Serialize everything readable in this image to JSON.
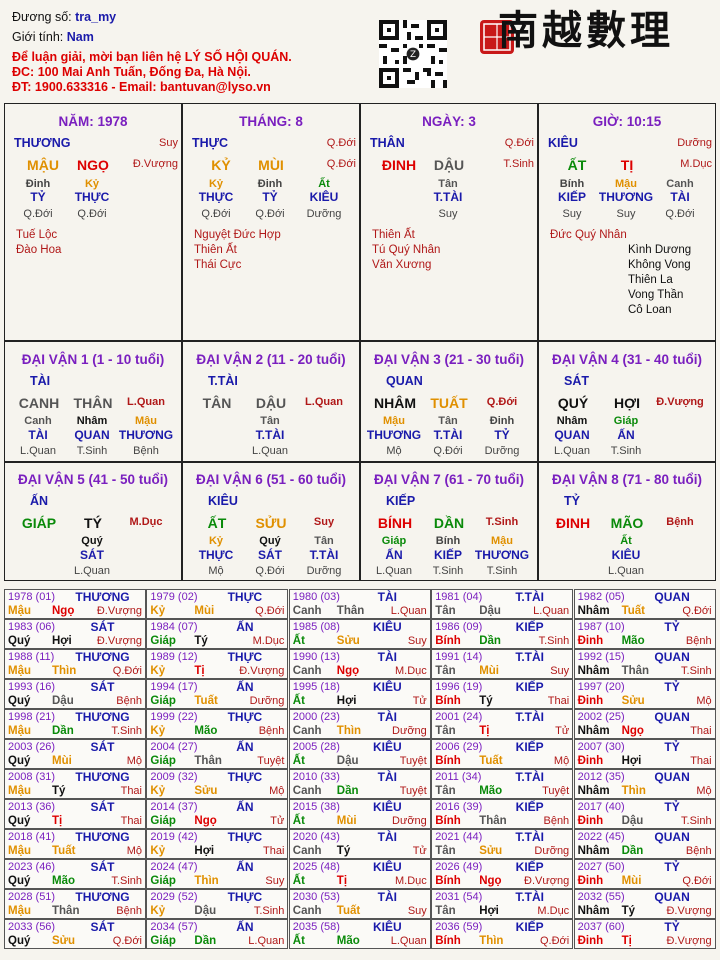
{
  "header": {
    "so_label": "Đương số:",
    "so": "tra_my",
    "gt_label": "Giới tính:",
    "gt": "Nam",
    "l1": "Để luận giải, mời bạn liên hệ LÝ SỐ HỘI QUÁN.",
    "l2": "ĐC: 100 Mai Anh Tuấn, Đống Đa, Hà Nội.",
    "l3": "ĐT: 1900.633316 - Email: bantuvan@lyso.vn",
    "logo": "南越數理",
    "seal": "瀚丰"
  },
  "pillars": [
    {
      "title": "NĂM: 1978",
      "top": "THƯƠNG",
      "top_r": "Suy",
      "can": "MẬU",
      "chi": "NGỌ",
      "chi_r": "Đ.Vượng",
      "h1": "Đinh",
      "h2": "Kỷ",
      "h3": "",
      "g1": "TỶ",
      "g2": "THỰC",
      "g3": "",
      "s1": "Q.Đới",
      "s2": "Q.Đới",
      "s3": "",
      "stars": [
        "Tuế Lộc",
        "Đào Hoa"
      ],
      "stars2": []
    },
    {
      "title": "THÁNG: 8",
      "top": "THỰC",
      "top_r": "Q.Đới",
      "can": "KỶ",
      "chi": "MÙI",
      "chi_r": "Q.Đới",
      "h1": "Kỷ",
      "h2": "Đinh",
      "h3": "Ất",
      "g1": "THỰC",
      "g2": "TỶ",
      "g3": "KIÊU",
      "s1": "Q.Đới",
      "s2": "Q.Đới",
      "s3": "Dưỡng",
      "stars": [
        "Nguyệt Đức Hợp",
        "Thiên Ất",
        "Thái Cực"
      ],
      "stars2": []
    },
    {
      "title": "NGÀY: 3",
      "top": "THÂN",
      "top_r": "Q.Đới",
      "can": "ĐINH",
      "chi": "DẬU",
      "chi_r": "T.Sinh",
      "h1": "",
      "h2": "Tân",
      "h3": "",
      "g1": "",
      "g2": "T.TÀI",
      "g3": "",
      "s1": "",
      "s2": "Suy",
      "s3": "",
      "stars": [
        "Thiên Ất",
        "Tú Quý Nhân",
        "Văn Xương"
      ],
      "stars2": []
    },
    {
      "title": "GIỜ: 10:15",
      "top": "KIÊU",
      "top_r": "Dưỡng",
      "can": "ẤT",
      "chi": "TỊ",
      "chi_r": "M.Dục",
      "h1": "Bính",
      "h2": "Mậu",
      "h3": "Canh",
      "g1": "KIẾP",
      "g2": "THƯƠNG",
      "g3": "TÀI",
      "s1": "Suy",
      "s2": "Suy",
      "s3": "Q.Đới",
      "stars": [
        "Đức Quý Nhân"
      ],
      "stars2": [
        "Kình Dương",
        "Không Vong",
        "Thiên La",
        "Vong Thần",
        "Cô Loan"
      ]
    }
  ],
  "daivan": [
    {
      "title": "ĐẠI VẬN 1 (1 - 10 tuổi)",
      "top": "TÀI",
      "can": "CANH",
      "chi": "THÂN",
      "chi_r": "L.Quan",
      "h1": "Canh",
      "h2": "Nhâm",
      "h3": "Mậu",
      "g1": "TÀI",
      "g2": "QUAN",
      "g3": "THƯƠNG",
      "s1": "L.Quan",
      "s2": "T.Sinh",
      "s3": "Bệnh"
    },
    {
      "title": "ĐẠI VẬN 2 (11 - 20 tuổi)",
      "top": "T.TÀI",
      "can": "TÂN",
      "chi": "DẬU",
      "chi_r": "L.Quan",
      "h1": "",
      "h2": "Tân",
      "h3": "",
      "g1": "",
      "g2": "T.TÀI",
      "g3": "",
      "s1": "",
      "s2": "L.Quan",
      "s3": ""
    },
    {
      "title": "ĐẠI VẬN 3 (21 - 30 tuổi)",
      "top": "QUAN",
      "can": "NHÂM",
      "chi": "TUẤT",
      "chi_r": "Q.Đới",
      "h1": "Mậu",
      "h2": "Tân",
      "h3": "Đinh",
      "g1": "THƯƠNG",
      "g2": "T.TÀI",
      "g3": "TỶ",
      "s1": "Mộ",
      "s2": "Q.Đới",
      "s3": "Dưỡng"
    },
    {
      "title": "ĐẠI VẬN 4 (31 - 40 tuổi)",
      "top": "SÁT",
      "can": "QUÝ",
      "chi": "HỢI",
      "chi_r": "Đ.Vượng",
      "h1": "Nhâm",
      "h2": "Giáp",
      "h3": "",
      "g1": "QUAN",
      "g2": "ẤN",
      "g3": "",
      "s1": "L.Quan",
      "s2": "T.Sinh",
      "s3": ""
    },
    {
      "title": "ĐẠI VẬN 5 (41 - 50 tuổi)",
      "top": "ẤN",
      "can": "GIÁP",
      "chi": "TÝ",
      "chi_r": "M.Dục",
      "h1": "",
      "h2": "Quý",
      "h3": "",
      "g1": "",
      "g2": "SÁT",
      "g3": "",
      "s1": "",
      "s2": "L.Quan",
      "s3": ""
    },
    {
      "title": "ĐẠI VẬN 6 (51 - 60 tuổi)",
      "top": "KIÊU",
      "can": "ẤT",
      "chi": "SỬU",
      "chi_r": "Suy",
      "h1": "Kỷ",
      "h2": "Quý",
      "h3": "Tân",
      "g1": "THỰC",
      "g2": "SÁT",
      "g3": "T.TÀI",
      "s1": "Mộ",
      "s2": "Q.Đới",
      "s3": "Dưỡng"
    },
    {
      "title": "ĐẠI VẬN 7 (61 - 70 tuổi)",
      "top": "KIẾP",
      "can": "BÍNH",
      "chi": "DẦN",
      "chi_r": "T.Sinh",
      "h1": "Giáp",
      "h2": "Bính",
      "h3": "Mậu",
      "g1": "ẤN",
      "g2": "KIẾP",
      "g3": "THƯƠNG",
      "s1": "L.Quan",
      "s2": "T.Sinh",
      "s3": "T.Sinh"
    },
    {
      "title": "ĐẠI VẬN 8 (71 - 80 tuổi)",
      "top": "TỶ",
      "can": "ĐINH",
      "chi": "MÃO",
      "chi_r": "Bệnh",
      "h1": "",
      "h2": "Ất",
      "h3": "",
      "g1": "",
      "g2": "KIÊU",
      "g3": "",
      "s1": "",
      "s2": "L.Quan",
      "s3": ""
    }
  ],
  "years": [
    [
      "1978 (01)",
      "THƯƠNG",
      "Mậu",
      "Ngọ",
      "Đ.Vượng"
    ],
    [
      "1979 (02)",
      "THỰC",
      "Kỷ",
      "Mùi",
      "Q.Đới"
    ],
    [
      "1980 (03)",
      "TÀI",
      "Canh",
      "Thân",
      "L.Quan"
    ],
    [
      "1981 (04)",
      "T.TÀI",
      "Tân",
      "Dậu",
      "L.Quan"
    ],
    [
      "1982 (05)",
      "QUAN",
      "Nhâm",
      "Tuất",
      "Q.Đới"
    ],
    [
      "1983 (06)",
      "SÁT",
      "Quý",
      "Hợi",
      "Đ.Vượng"
    ],
    [
      "1984 (07)",
      "ẤN",
      "Giáp",
      "Tý",
      "M.Dục"
    ],
    [
      "1985 (08)",
      "KIÊU",
      "Ất",
      "Sửu",
      "Suy"
    ],
    [
      "1986 (09)",
      "KIẾP",
      "Bính",
      "Dần",
      "T.Sinh"
    ],
    [
      "1987 (10)",
      "TỶ",
      "Đinh",
      "Mão",
      "Bệnh"
    ],
    [
      "1988 (11)",
      "THƯƠNG",
      "Mậu",
      "Thìn",
      "Q.Đới"
    ],
    [
      "1989 (12)",
      "THỰC",
      "Kỷ",
      "Tị",
      "Đ.Vượng"
    ],
    [
      "1990 (13)",
      "TÀI",
      "Canh",
      "Ngọ",
      "M.Dục"
    ],
    [
      "1991 (14)",
      "T.TÀI",
      "Tân",
      "Mùi",
      "Suy"
    ],
    [
      "1992 (15)",
      "QUAN",
      "Nhâm",
      "Thân",
      "T.Sinh"
    ],
    [
      "1993 (16)",
      "SÁT",
      "Quý",
      "Dậu",
      "Bệnh"
    ],
    [
      "1994 (17)",
      "ẤN",
      "Giáp",
      "Tuất",
      "Dưỡng"
    ],
    [
      "1995 (18)",
      "KIÊU",
      "Ất",
      "Hợi",
      "Tử"
    ],
    [
      "1996 (19)",
      "KIẾP",
      "Bính",
      "Tý",
      "Thai"
    ],
    [
      "1997 (20)",
      "TỶ",
      "Đinh",
      "Sửu",
      "Mộ"
    ],
    [
      "1998 (21)",
      "THƯƠNG",
      "Mậu",
      "Dần",
      "T.Sinh"
    ],
    [
      "1999 (22)",
      "THỰC",
      "Kỷ",
      "Mão",
      "Bệnh"
    ],
    [
      "2000 (23)",
      "TÀI",
      "Canh",
      "Thìn",
      "Dưỡng"
    ],
    [
      "2001 (24)",
      "T.TÀI",
      "Tân",
      "Tị",
      "Tử"
    ],
    [
      "2002 (25)",
      "QUAN",
      "Nhâm",
      "Ngọ",
      "Thai"
    ],
    [
      "2003 (26)",
      "SÁT",
      "Quý",
      "Mùi",
      "Mộ"
    ],
    [
      "2004 (27)",
      "ẤN",
      "Giáp",
      "Thân",
      "Tuyệt"
    ],
    [
      "2005 (28)",
      "KIÊU",
      "Ất",
      "Dậu",
      "Tuyệt"
    ],
    [
      "2006 (29)",
      "KIẾP",
      "Bính",
      "Tuất",
      "Mộ"
    ],
    [
      "2007 (30)",
      "TỶ",
      "Đinh",
      "Hợi",
      "Thai"
    ],
    [
      "2008 (31)",
      "THƯƠNG",
      "Mậu",
      "Tý",
      "Thai"
    ],
    [
      "2009 (32)",
      "THỰC",
      "Kỷ",
      "Sửu",
      "Mộ"
    ],
    [
      "2010 (33)",
      "TÀI",
      "Canh",
      "Dần",
      "Tuyệt"
    ],
    [
      "2011 (34)",
      "T.TÀI",
      "Tân",
      "Mão",
      "Tuyệt"
    ],
    [
      "2012 (35)",
      "QUAN",
      "Nhâm",
      "Thìn",
      "Mộ"
    ],
    [
      "2013 (36)",
      "SÁT",
      "Quý",
      "Tị",
      "Thai"
    ],
    [
      "2014 (37)",
      "ẤN",
      "Giáp",
      "Ngọ",
      "Tử"
    ],
    [
      "2015 (38)",
      "KIÊU",
      "Ất",
      "Mùi",
      "Dưỡng"
    ],
    [
      "2016 (39)",
      "KIẾP",
      "Bính",
      "Thân",
      "Bệnh"
    ],
    [
      "2017 (40)",
      "TỶ",
      "Đinh",
      "Dậu",
      "T.Sinh"
    ],
    [
      "2018 (41)",
      "THƯƠNG",
      "Mậu",
      "Tuất",
      "Mộ"
    ],
    [
      "2019 (42)",
      "THỰC",
      "Kỷ",
      "Hợi",
      "Thai"
    ],
    [
      "2020 (43)",
      "TÀI",
      "Canh",
      "Tý",
      "Tử"
    ],
    [
      "2021 (44)",
      "T.TÀI",
      "Tân",
      "Sửu",
      "Dưỡng"
    ],
    [
      "2022 (45)",
      "QUAN",
      "Nhâm",
      "Dần",
      "Bệnh"
    ],
    [
      "2023 (46)",
      "SÁT",
      "Quý",
      "Mão",
      "T.Sinh"
    ],
    [
      "2024 (47)",
      "ẤN",
      "Giáp",
      "Thìn",
      "Suy"
    ],
    [
      "2025 (48)",
      "KIÊU",
      "Ất",
      "Tị",
      "M.Dục"
    ],
    [
      "2026 (49)",
      "KIẾP",
      "Bính",
      "Ngọ",
      "Đ.Vượng"
    ],
    [
      "2027 (50)",
      "TỶ",
      "Đinh",
      "Mùi",
      "Q.Đới"
    ],
    [
      "2028 (51)",
      "THƯƠNG",
      "Mậu",
      "Thân",
      "Bệnh"
    ],
    [
      "2029 (52)",
      "THỰC",
      "Kỷ",
      "Dậu",
      "T.Sinh"
    ],
    [
      "2030 (53)",
      "TÀI",
      "Canh",
      "Tuất",
      "Suy"
    ],
    [
      "2031 (54)",
      "T.TÀI",
      "Tân",
      "Hợi",
      "M.Dục"
    ],
    [
      "2032 (55)",
      "QUAN",
      "Nhâm",
      "Tý",
      "Đ.Vượng"
    ],
    [
      "2033 (56)",
      "SÁT",
      "Quý",
      "Sửu",
      "Q.Đới"
    ],
    [
      "2034 (57)",
      "ẤN",
      "Giáp",
      "Dần",
      "L.Quan"
    ],
    [
      "2035 (58)",
      "KIÊU",
      "Ất",
      "Mão",
      "L.Quan"
    ],
    [
      "2036 (59)",
      "KIẾP",
      "Bính",
      "Thìn",
      "Q.Đới"
    ],
    [
      "2037 (60)",
      "TỶ",
      "Đinh",
      "Tị",
      "Đ.Vượng"
    ]
  ],
  "colors": {
    "Mộc": "#0a8a0a",
    "Hỏa": "#d00000",
    "Thổ": "#e09000",
    "Kim": "#555555",
    "Thủy": "#111111"
  }
}
